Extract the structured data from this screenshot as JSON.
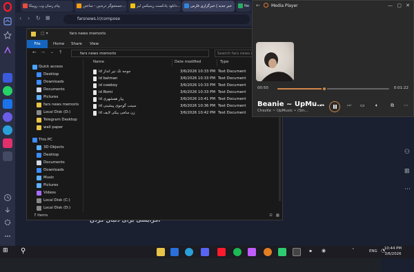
{
  "browser": {
    "tabs": [
      {
        "label": "پیام رسان وب روبیکا"
      },
      {
        "label": "جستجوگر ذره‌بین - ساختن..."
      },
      {
        "label": "دانلود پادکست ریمیکس لیر..."
      },
      {
        "label": "خبر جدید | خبرگزاری فارس"
      },
      {
        "label": "Ne"
      }
    ],
    "url": "farsnews.ir/compose"
  },
  "explorer": {
    "title": "fars news memoris",
    "ribbon_tabs": [
      "File",
      "Home",
      "Share",
      "View"
    ],
    "path": "fars news memoris",
    "search_placeholder": "Search fars news me...",
    "nav_pane": [
      {
        "label": "Quick access"
      },
      {
        "label": "Desktop"
      },
      {
        "label": "Downloads"
      },
      {
        "label": "Documents"
      },
      {
        "label": "Pictures"
      },
      {
        "label": "fars news memoris"
      },
      {
        "label": "Local Disk (D:)"
      },
      {
        "label": "Telegram Desktop"
      },
      {
        "label": "wall paper"
      },
      {
        "label": "This PC"
      },
      {
        "label": "3D Objects"
      },
      {
        "label": "Desktop"
      },
      {
        "label": "Documents"
      },
      {
        "label": "Downloads"
      },
      {
        "label": "Music"
      },
      {
        "label": "Pictures"
      },
      {
        "label": "Videos"
      },
      {
        "label": "Local Disk (C:)"
      },
      {
        "label": "Local Disk (D:)"
      }
    ],
    "columns": {
      "name": "Name",
      "date": "Date modified",
      "type": "Type"
    },
    "files": [
      {
        "name": "id جوجه تک تیر انداز",
        "date": "3/6/2026 10:33 PM",
        "type": "Text Document"
      },
      {
        "name": "id batman",
        "date": "3/6/2026 10:33 PM",
        "type": "Text Document"
      },
      {
        "name": "id cowboy",
        "date": "3/6/2026 10:33 PM",
        "type": "Text Document"
      },
      {
        "name": "id Romi",
        "date": "3/6/2026 10:33 PM",
        "type": "Text Document"
      },
      {
        "name": "id پیار همشهری",
        "date": "3/6/2026 10:41 PM",
        "type": "Text Document"
      },
      {
        "name": "id سینب گوجوی پیشینی",
        "date": "3/6/2026 10:36 PM",
        "type": "Text Document"
      },
      {
        "name": "id زن سامی بیکی لایف",
        "date": "3/6/2026 10:42 PM",
        "type": "Text Document"
      }
    ],
    "status": "7 items"
  },
  "media_player": {
    "app_title": "Media Player",
    "song": "Beanie ~ UpMu...",
    "artist": "Chezile ~ UpMusic • (Sin...",
    "elapsed": "00:50",
    "total": "0:01:22",
    "progress": 0.42,
    "accent": "#d48a4a"
  },
  "webpage": {
    "hint_text": "افزایشی برای دنبال کردن"
  },
  "taskbar": {
    "language": "ENG",
    "time": "10:44 PM",
    "date": "3/6/2026"
  }
}
